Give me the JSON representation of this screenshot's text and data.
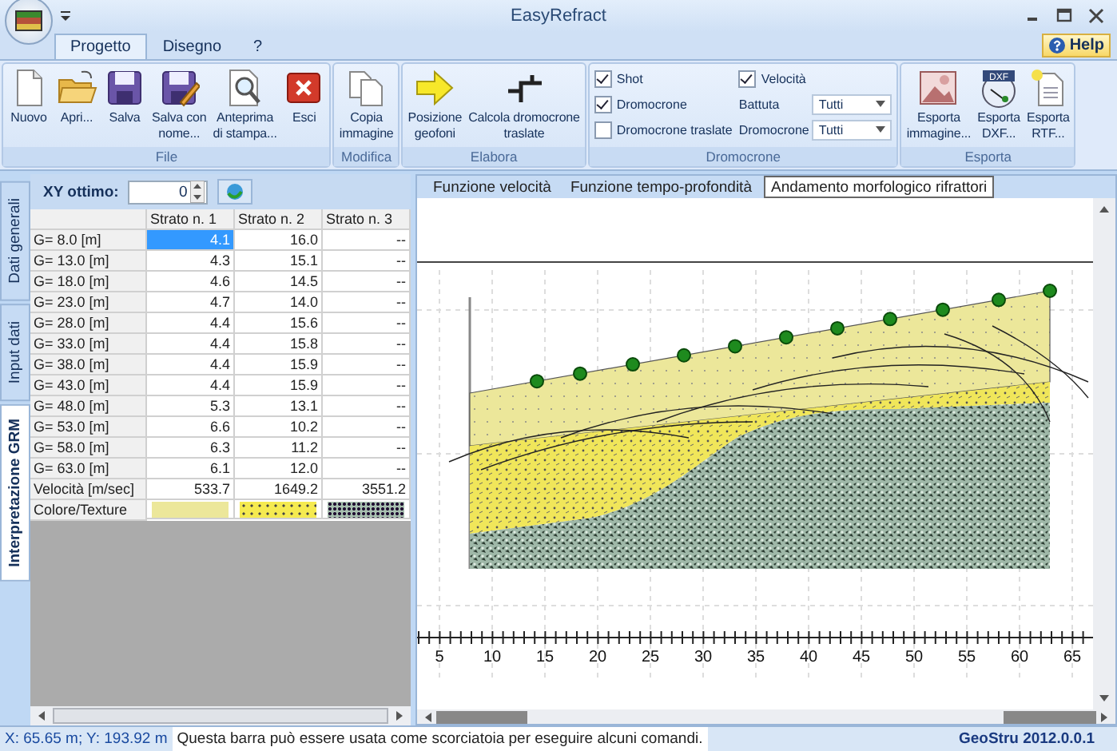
{
  "window": {
    "title": "EasyRefract"
  },
  "ribbon_tabs": [
    {
      "label": "Progetto",
      "selected": true
    },
    {
      "label": "Disegno",
      "selected": false
    },
    {
      "label": "?",
      "selected": false
    }
  ],
  "help_button": {
    "label": "Help"
  },
  "ribbon_groups": [
    {
      "title": "File",
      "kind": "buttons",
      "buttons": [
        {
          "label": "Nuovo",
          "kind": "new"
        },
        {
          "label": "Apri...",
          "kind": "open"
        },
        {
          "label": "Salva",
          "kind": "save"
        },
        {
          "label": "Salva con\nnome...",
          "kind": "save-as"
        },
        {
          "label": "Anteprima\ndi stampa...",
          "kind": "preview"
        },
        {
          "label": "Esci",
          "kind": "exit"
        }
      ]
    },
    {
      "title": "Modifica",
      "kind": "buttons",
      "buttons": [
        {
          "label": "Copia\nimmagine",
          "kind": "copy"
        }
      ]
    },
    {
      "title": "Elabora",
      "kind": "buttons",
      "buttons": [
        {
          "label": "Posizione\ngeofoni",
          "kind": "arrow"
        },
        {
          "label": "Calcola dromocrone\ntraslate",
          "kind": "shift"
        }
      ]
    },
    {
      "title": "Dromocrone",
      "kind": "options",
      "columns": [
        {
          "items": [
            {
              "kind": "checkbox",
              "label": "Shot",
              "checked": true
            },
            {
              "kind": "checkbox",
              "label": "Dromocrone",
              "checked": true
            },
            {
              "kind": "checkbox",
              "label": "Dromocrone traslate",
              "checked": false
            }
          ]
        },
        {
          "items": [
            {
              "kind": "checkbox",
              "label": "Velocità",
              "checked": true
            },
            {
              "kind": "dropdown",
              "label": "Battuta",
              "value": "Tutti"
            },
            {
              "kind": "dropdown",
              "label": "Dromocrone",
              "value": "Tutti"
            }
          ]
        }
      ]
    },
    {
      "title": "Esporta",
      "kind": "buttons",
      "buttons": [
        {
          "label": "Esporta\nimmagine...",
          "kind": "image"
        },
        {
          "label": "Esporta\nDXF...",
          "kind": "dxf",
          "icon_text": "DXF"
        },
        {
          "label": "Esporta\nRTF...",
          "kind": "rtf"
        }
      ]
    }
  ],
  "side_tabs": [
    {
      "label": "Dati generali",
      "selected": false
    },
    {
      "label": "Input dati",
      "selected": false
    },
    {
      "label": "Interpretazione GRM",
      "selected": true
    }
  ],
  "xy_optimum": {
    "label": "XY ottimo:",
    "value": "0"
  },
  "strata_table": {
    "columns": [
      "Strato n. 1",
      "Strato n. 2",
      "Strato n. 3"
    ],
    "rows": [
      {
        "label": "G= 8.0 [m]",
        "cells": [
          {
            "text": "4.1",
            "selected": true
          },
          {
            "text": "16.0",
            "selected": false
          },
          {
            "text": "--",
            "selected": false
          }
        ]
      },
      {
        "label": "G= 13.0 [m]",
        "cells": [
          {
            "text": "4.3",
            "selected": false
          },
          {
            "text": "15.1",
            "selected": false
          },
          {
            "text": "--",
            "selected": false
          }
        ]
      },
      {
        "label": "G= 18.0 [m]",
        "cells": [
          {
            "text": "4.6",
            "selected": false
          },
          {
            "text": "14.5",
            "selected": false
          },
          {
            "text": "--",
            "selected": false
          }
        ]
      },
      {
        "label": "G= 23.0 [m]",
        "cells": [
          {
            "text": "4.7",
            "selected": false
          },
          {
            "text": "14.0",
            "selected": false
          },
          {
            "text": "--",
            "selected": false
          }
        ]
      },
      {
        "label": "G= 28.0 [m]",
        "cells": [
          {
            "text": "4.4",
            "selected": false
          },
          {
            "text": "15.6",
            "selected": false
          },
          {
            "text": "--",
            "selected": false
          }
        ]
      },
      {
        "label": "G= 33.0 [m]",
        "cells": [
          {
            "text": "4.4",
            "selected": false
          },
          {
            "text": "15.8",
            "selected": false
          },
          {
            "text": "--",
            "selected": false
          }
        ]
      },
      {
        "label": "G= 38.0 [m]",
        "cells": [
          {
            "text": "4.4",
            "selected": false
          },
          {
            "text": "15.9",
            "selected": false
          },
          {
            "text": "--",
            "selected": false
          }
        ]
      },
      {
        "label": "G= 43.0 [m]",
        "cells": [
          {
            "text": "4.4",
            "selected": false
          },
          {
            "text": "15.9",
            "selected": false
          },
          {
            "text": "--",
            "selected": false
          }
        ]
      },
      {
        "label": "G= 48.0 [m]",
        "cells": [
          {
            "text": "5.3",
            "selected": false
          },
          {
            "text": "13.1",
            "selected": false
          },
          {
            "text": "--",
            "selected": false
          }
        ]
      },
      {
        "label": "G= 53.0 [m]",
        "cells": [
          {
            "text": "6.6",
            "selected": false
          },
          {
            "text": "10.2",
            "selected": false
          },
          {
            "text": "--",
            "selected": false
          }
        ]
      },
      {
        "label": "G= 58.0 [m]",
        "cells": [
          {
            "text": "6.3",
            "selected": false
          },
          {
            "text": "11.2",
            "selected": false
          },
          {
            "text": "--",
            "selected": false
          }
        ]
      },
      {
        "label": "G= 63.0 [m]",
        "cells": [
          {
            "text": "6.1",
            "selected": false
          },
          {
            "text": "12.0",
            "selected": false
          },
          {
            "text": "--",
            "selected": false
          }
        ]
      }
    ],
    "velocity_row": {
      "label": "Velocità [m/sec]",
      "cells": [
        "533.7",
        "1649.2",
        "3551.2"
      ]
    },
    "texture_row": {
      "label": "Colore/Texture",
      "textures": [
        {
          "kind": "plain-yellow"
        },
        {
          "kind": "dotted-yellow"
        },
        {
          "kind": "gravel"
        }
      ]
    }
  },
  "view_tabs": [
    {
      "label": "Funzione velocità",
      "selected": false
    },
    {
      "label": "Funzione tempo-profondità",
      "selected": false
    },
    {
      "label": "Andamento morfologico rifrattori",
      "selected": true
    }
  ],
  "section": {
    "axis_labels": [
      "5",
      "10",
      "15",
      "20",
      "25",
      "30",
      "35",
      "40",
      "45",
      "50",
      "55",
      "60",
      "65"
    ]
  },
  "status_bar": {
    "coordinates": "X: 65.65 m; Y: 193.92 m",
    "message": "Questa barra può essere usata come scorciatoia per eseguire alcuni comandi.",
    "version": "GeoStru 2012.0.0.1"
  }
}
